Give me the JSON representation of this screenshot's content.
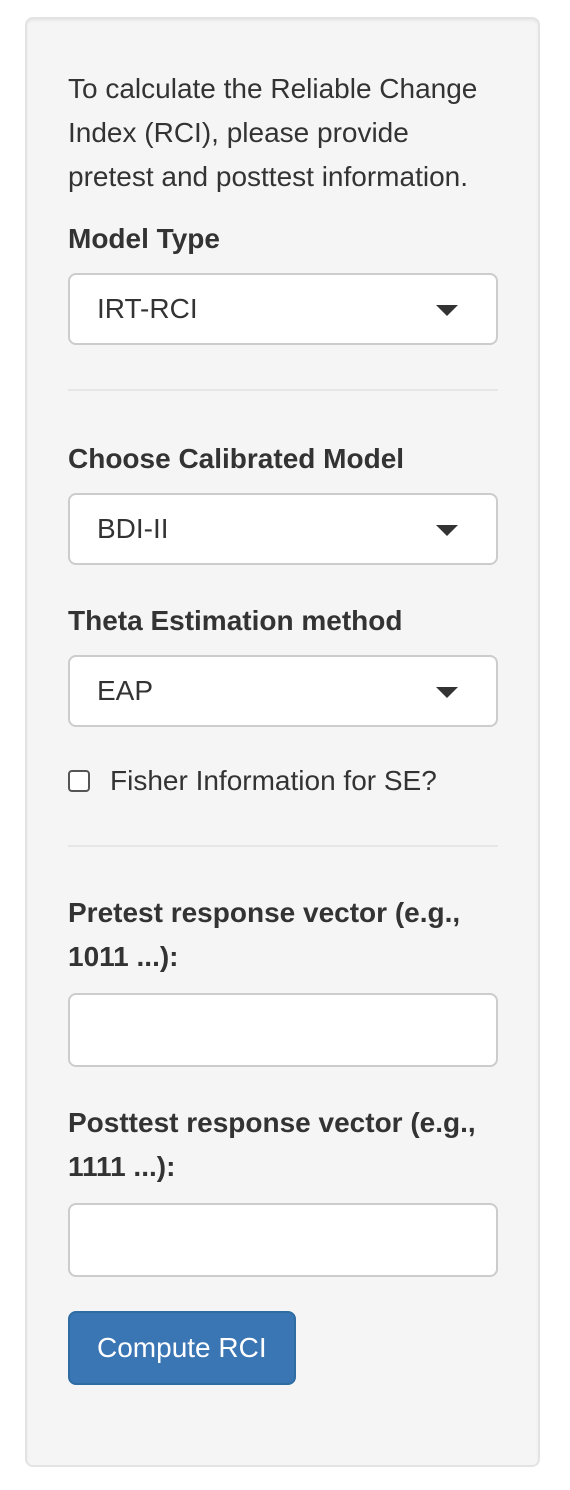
{
  "panel": {
    "intro_text": "To calculate the Reliable Change Index (RCI), please provide pretest and posttest information."
  },
  "model_type": {
    "label": "Model Type",
    "selected": "IRT-RCI"
  },
  "calibrated_model": {
    "label": "Choose Calibrated Model",
    "selected": "BDI-II"
  },
  "theta_method": {
    "label": "Theta Estimation method",
    "selected": "EAP"
  },
  "fisher_info": {
    "label": "Fisher Information for SE?",
    "checked": false
  },
  "pretest": {
    "label": "Pretest response vector (e.g., 1011 ...):",
    "value": ""
  },
  "posttest": {
    "label": "Posttest response vector (e.g., 1111 ...):",
    "value": ""
  },
  "actions": {
    "compute_label": "Compute RCI"
  },
  "colors": {
    "panel_bg": "#f5f5f5",
    "button_bg": "#3a75b4",
    "text": "#333333"
  }
}
